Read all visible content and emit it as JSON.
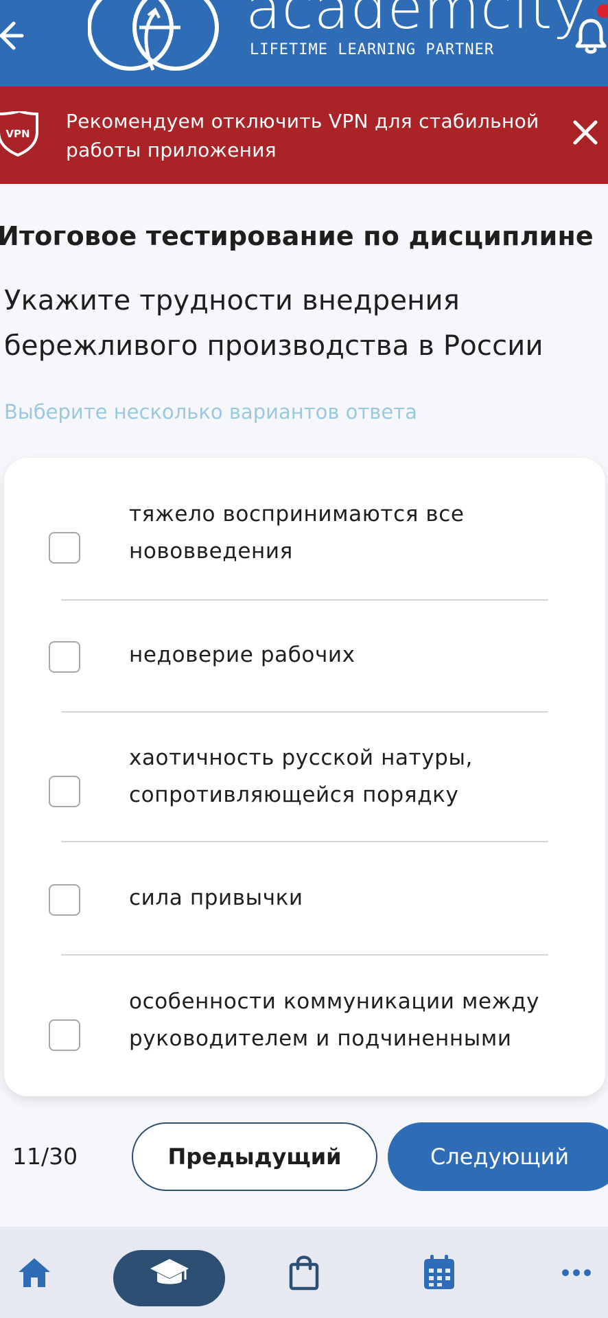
{
  "header": {
    "logo_word": "academcity",
    "logo_tagline": "LIFETIME LEARNING PARTNER"
  },
  "banner": {
    "badge": "VPN",
    "text": "Рекомендуем отключить VPN для стабильной работы приложения"
  },
  "test": {
    "title": "Итоговое тестирование по дисциплине",
    "question": "Укажите трудности внедрения бережливого производства в России",
    "hint": "Выберите несколько вариантов ответа",
    "options": [
      {
        "label": "тяжело воспринимаются все нововведения",
        "checked": false
      },
      {
        "label": "недоверие рабочих",
        "checked": false
      },
      {
        "label": "хаотичность русской натуры, сопротивляющейся порядку",
        "checked": false
      },
      {
        "label": "сила привычки",
        "checked": false
      },
      {
        "label": "особенности коммуникации между руководителем и подчиненными",
        "checked": false
      }
    ]
  },
  "pagination": {
    "counter": "11/30",
    "prev_label": "Предыдущий",
    "next_label": "Следующий"
  },
  "bottom_nav": {
    "items": [
      {
        "icon": "home-icon",
        "active": false
      },
      {
        "icon": "graduation-cap-icon",
        "active": true
      },
      {
        "icon": "shopping-bag-icon",
        "active": false
      },
      {
        "icon": "calendar-icon",
        "active": false
      },
      {
        "icon": "more-icon",
        "active": false
      }
    ]
  },
  "colors": {
    "primary": "#2e6db5",
    "banner": "#a92327",
    "hint": "#9cc8de",
    "nav_active": "#2c4f73"
  }
}
